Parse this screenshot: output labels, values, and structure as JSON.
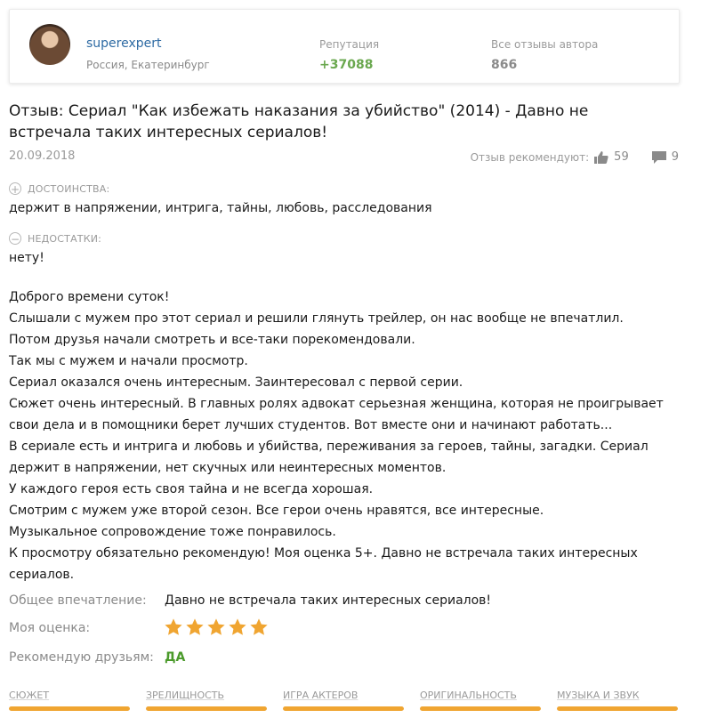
{
  "author": {
    "username": "superexpert",
    "location": "Россия, Екатеринбург",
    "reputation_label": "Репутация",
    "reputation_value": "+37088",
    "all_reviews_label": "Все отзывы автора",
    "all_reviews_value": "866"
  },
  "review": {
    "title": "Отзыв: Сериал \"Как избежать наказания за убийство\" (2014) - Давно не встречала таких интересных сериалов!",
    "date": "20.09.2018",
    "recommend_label": "Отзыв рекомендуют:",
    "likes": "59",
    "comments": "9",
    "pros_label": "ДОСТОИНСТВА:",
    "pros_text": "держит в напряжении, интрига, тайны, любовь, расследования",
    "cons_label": "НЕДОСТАТКИ:",
    "cons_text": "нету!",
    "body": [
      "Доброго времени суток!",
      "Слышали с мужем про этот сериал и решили глянуть трейлер, он нас вообще не впечатлил.",
      "Потом друзья начали смотреть и все-таки порекомендовали.",
      "Так мы с мужем и начали просмотр.",
      "Сериал оказался очень интересным. Заинтересовал с первой серии.",
      "Сюжет очень интересный. В главных ролях адвокат серьезная женщина, которая не проигрывает свои дела и в помощники берет лучших студентов. Вот вместе они и начинают работать...",
      "В сериале есть и интрига и любовь и убийства, переживания за героев, тайны, загадки. Сериал держит в напряжении, нет скучных или неинтересных моментов.",
      "У каждого героя есть своя тайна и не всегда хорошая.",
      "Смотрим с мужем уже второй сезон. Все герои очень нравятся, все интересные.",
      "Музыкальное сопровождение тоже понравилось.",
      "К просмотру обязательно рекомендую! Моя оценка 5+. Давно не встречала таких интересных сериалов."
    ],
    "impression_label": "Общее впечатление:",
    "impression_value": "Давно не встречала таких интересных сериалов!",
    "rating_label": "Моя оценка:",
    "rating_stars": 5,
    "recommend_friends_label": "Рекомендую друзьям:",
    "recommend_friends_value": "ДА"
  },
  "ratings": [
    {
      "label": "СЮЖЕТ",
      "value": 1.0
    },
    {
      "label": "ЗРЕЛИЩНОСТЬ",
      "value": 1.0
    },
    {
      "label": "ИГРА АКТЕРОВ",
      "value": 1.0
    },
    {
      "label": "ОРИГИНАЛЬНОСТЬ",
      "value": 1.0
    },
    {
      "label": "МУЗЫКА И ЗВУК",
      "value": 1.0
    }
  ],
  "colors": {
    "accent_star": "#f0a531",
    "rating_fill": "#f0a531",
    "reputation": "#6aa84f",
    "link": "#2d6aa3"
  },
  "icons": [
    "thumb-up-icon",
    "comment-icon",
    "plus-icon",
    "minus-icon",
    "star-icon"
  ]
}
